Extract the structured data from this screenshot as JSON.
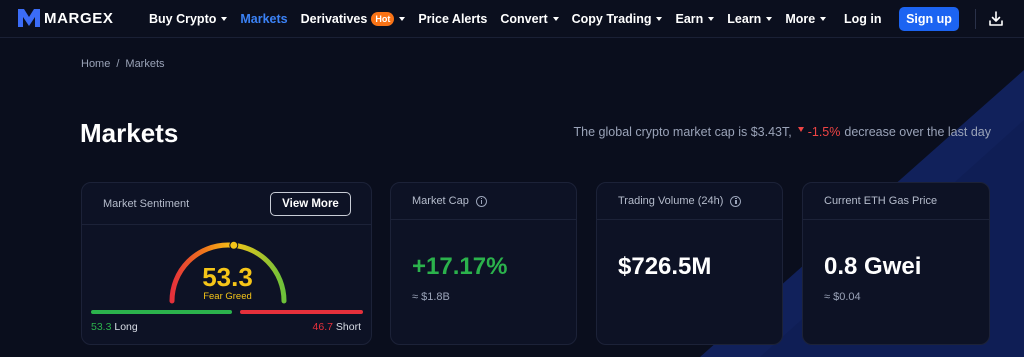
{
  "brand": {
    "name": "MARGEX"
  },
  "nav": {
    "items": [
      {
        "label": "Buy Crypto",
        "caret": true,
        "active": false
      },
      {
        "label": "Markets",
        "caret": false,
        "active": true
      },
      {
        "label": "Derivatives",
        "caret": true,
        "active": false,
        "badge": "Hot"
      },
      {
        "label": "Price Alerts",
        "caret": false,
        "active": false
      },
      {
        "label": "Convert",
        "caret": true,
        "active": false
      },
      {
        "label": "Copy Trading",
        "caret": true,
        "active": false
      },
      {
        "label": "Earn",
        "caret": true,
        "active": false
      },
      {
        "label": "Learn",
        "caret": true,
        "active": false
      },
      {
        "label": "More",
        "caret": true,
        "active": false
      }
    ],
    "login_label": "Log in",
    "signup_label": "Sign up",
    "download_icon": "download-icon"
  },
  "breadcrumb": {
    "home": "Home",
    "separator": "/",
    "current": "Markets"
  },
  "page": {
    "title": "Markets",
    "summary_prefix": "The global crypto market cap is $3.43T,",
    "summary_change": "-1.5%",
    "summary_suffix": "decrease over the last day"
  },
  "sentiment": {
    "label": "Market Sentiment",
    "view_more": "View More",
    "value": "53.3",
    "caption": "Fear Greed",
    "gauge_fraction": 0.533,
    "long_value": "53.3",
    "long_label": "Long",
    "short_value": "46.7",
    "short_label": "Short"
  },
  "market_cap": {
    "label": "Market Cap",
    "value": "+17.17%",
    "sub": "≈ $1.8B"
  },
  "trading_volume": {
    "label": "Trading Volume (24h)",
    "value": "$726.5M"
  },
  "gas": {
    "label": "Current ETH Gas Price",
    "value": "0.8 Gwei",
    "sub": "≈ $0.04"
  },
  "colors": {
    "accent": "#1c64f2",
    "positive": "#2bb24c",
    "negative": "#e5303b",
    "gauge_value": "#f5c518",
    "hot_badge": "#f97316"
  }
}
